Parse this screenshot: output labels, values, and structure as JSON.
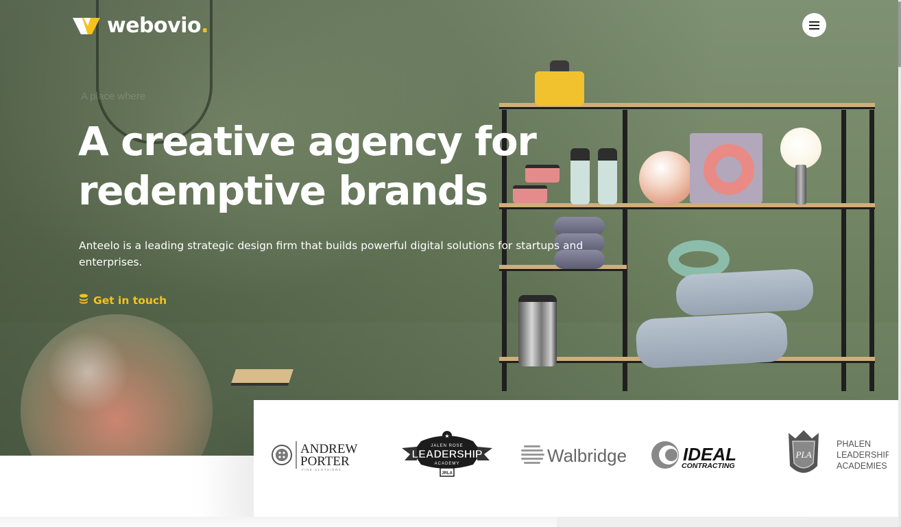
{
  "header": {
    "logo_text": "webovio",
    "logo_dot": ".",
    "menu_icon": "hamburger-icon"
  },
  "hero": {
    "tagline": "A place where",
    "headline_line1": "A creative agency for",
    "headline_line2": "redemptive brands",
    "description": "Anteelo is a leading strategic design firm that builds powerful digital solutions for startups and enterprises.",
    "cta_label": "Get in touch",
    "cta_icon": "coins-icon"
  },
  "clients": {
    "andrew_porter": {
      "line1": "ANDREW",
      "line2": "PORTER",
      "line3": "FINE CLOTHIERS"
    },
    "leadership_academy": {
      "top": "JALEN ROSE",
      "main": "LEADERSHIP",
      "sub": "ACADEMY",
      "badge": "JRLA"
    },
    "walbridge": {
      "name": "Walbridge"
    },
    "ideal": {
      "name": "IDEAL",
      "sub": "CONTRACTING"
    },
    "phalen": {
      "monogram": "PLA",
      "line1": "PHALEN",
      "line2": "LEADERSHIP",
      "line3": "ACADEMIES"
    }
  },
  "colors": {
    "accent": "#f6c21c",
    "hero_bg": "#748766",
    "text_light": "#ffffff"
  }
}
